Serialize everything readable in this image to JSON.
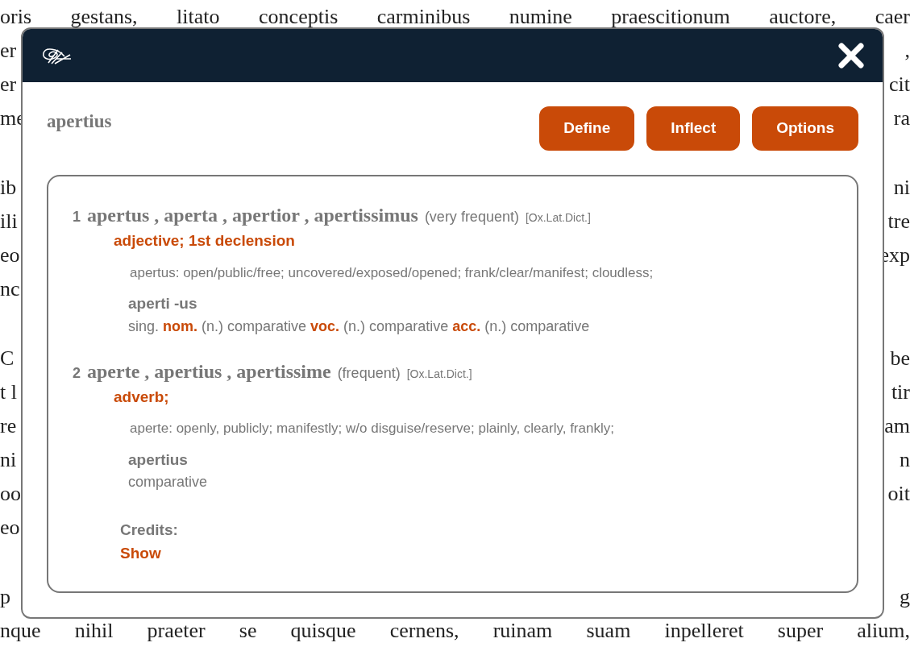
{
  "background_text": [
    [
      {
        "left": "oris gestans, litato conceptis carminibus numine praescitionum auctore, caer"
      },
      {
        "left": "er",
        "right": ","
      },
      {
        "left": "er",
        "right": "cit"
      },
      {
        "left": "me",
        "right": "ra"
      }
    ],
    [
      {
        "left": "ib",
        "right": "ni"
      },
      {
        "left": "ili",
        "right": "tre"
      },
      {
        "left": "eo",
        "right": "exp"
      },
      {
        "left": "nc"
      }
    ],
    [
      {
        "left": "C",
        "right": "be"
      },
      {
        "left": "t l",
        "right": "tir"
      },
      {
        "left": "re",
        "right": "am"
      },
      {
        "left": "ni",
        "right": "n"
      },
      {
        "left": "oo",
        "right": "oit"
      },
      {
        "left": "eo"
      }
    ],
    [
      {
        "left": "p",
        "right": "g"
      },
      {
        "left": "nque nihil praeter se quisque cernens, ruinam suam inpelleret super alium,"
      }
    ]
  ],
  "popup": {
    "query": "apertius",
    "buttons": [
      "Define",
      "Inflect",
      "Options"
    ],
    "entries": [
      {
        "number": "1",
        "headwords": "apertus , aperta , apertior , apertissimus",
        "frequency": "(very frequent)",
        "source": "[Ox.Lat.Dict.]",
        "pos": "adjective; 1st declension",
        "meaning": "apertus: open/public/free; uncovered/exposed/opened; frank/clear/manifest; cloudless;",
        "forms": [
          {
            "stem": "aperti -us",
            "parsing": "sing. **nom.** (n.) comparative **voc.** (n.) comparative **acc.** (n.) comparative"
          }
        ]
      },
      {
        "number": "2",
        "headwords": "aperte , apertius , apertissime",
        "frequency": "(frequent)",
        "source": "[Ox.Lat.Dict.]",
        "pos": "adverb;",
        "meaning": "aperte: openly, publicly; manifestly; w/o disguise/reserve; plainly, clearly, frankly;",
        "forms": [
          {
            "stem": "apertius",
            "parsing": "comparative"
          }
        ]
      }
    ],
    "credits": {
      "label": "Credits:",
      "link": "Show"
    }
  }
}
